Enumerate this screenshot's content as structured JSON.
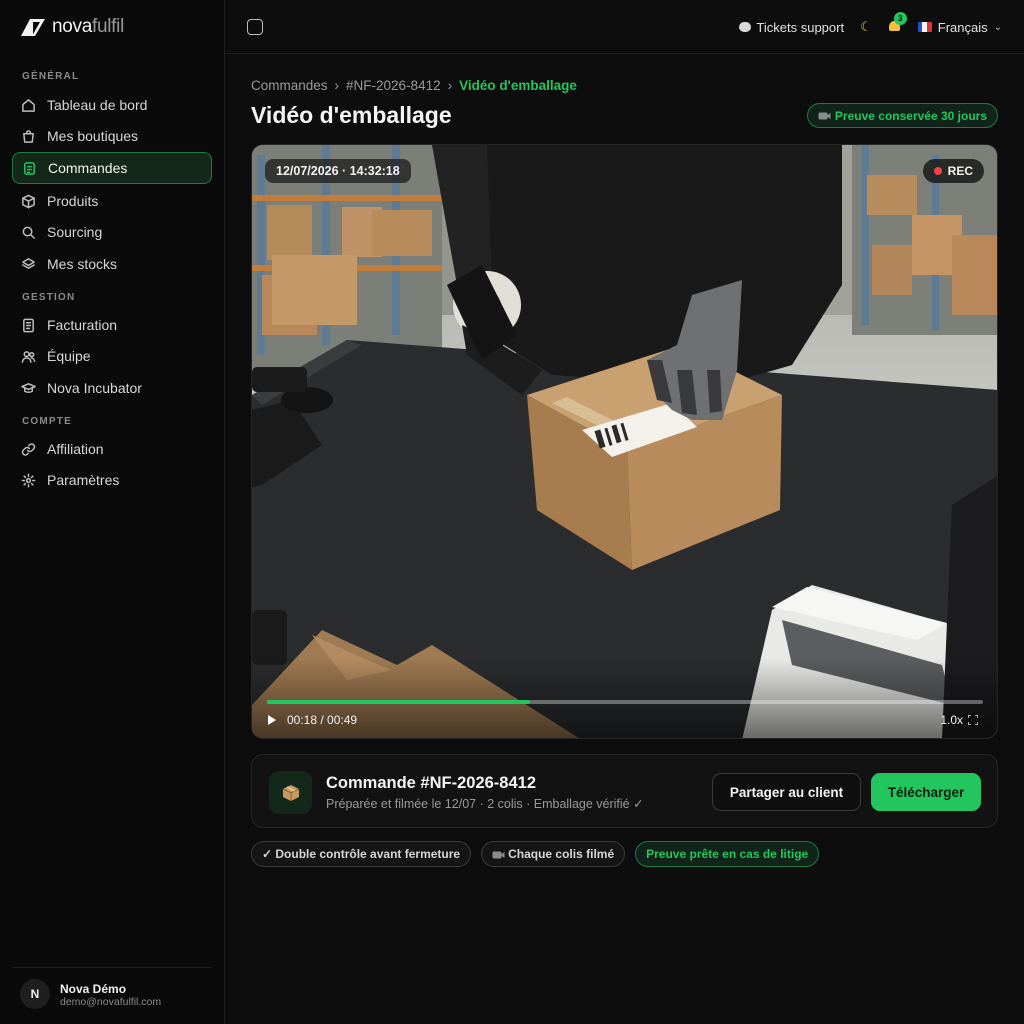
{
  "brand": {
    "name_main": "nova",
    "name_light": "fulfil"
  },
  "sidebar": {
    "sections": [
      {
        "label": "GÉNÉRAL"
      },
      {
        "label": "GESTION"
      },
      {
        "label": "COMPTE"
      }
    ],
    "items": [
      {
        "label": "Tableau de bord",
        "icon": "home-icon"
      },
      {
        "label": "Mes boutiques",
        "icon": "shopping-bag-icon"
      },
      {
        "label": "Commandes",
        "icon": "clipboard-icon",
        "active": true
      },
      {
        "label": "Produits",
        "icon": "cube-icon"
      },
      {
        "label": "Sourcing",
        "icon": "search-icon"
      },
      {
        "label": "Mes stocks",
        "icon": "layers-icon"
      },
      {
        "label": "Facturation",
        "icon": "invoice-icon"
      },
      {
        "label": "Équipe",
        "icon": "users-icon"
      },
      {
        "label": "Nova Incubator",
        "icon": "graduation-cap-icon"
      },
      {
        "label": "Affiliation",
        "icon": "link-icon"
      },
      {
        "label": "Paramètres",
        "icon": "gear-icon"
      }
    ],
    "user": {
      "initial": "N",
      "name": "Nova Démo",
      "email": "demo@novafulfil.com"
    }
  },
  "topbar": {
    "tickets_label": "Tickets support",
    "notification_count": "3",
    "language": "Français"
  },
  "breadcrumb": {
    "items": [
      "Commandes",
      "#NF-2026-8412",
      "Vidéo d'emballage"
    ],
    "separator": "›"
  },
  "page": {
    "title": "Vidéo d'emballage",
    "proof_pill": "Preuve conservée 30 jours"
  },
  "video": {
    "timestamp": "12/07/2026 · 14:32:18",
    "rec_label": "REC",
    "current_time": "00:18",
    "duration": "00:49",
    "time_display": "00:18 / 00:49",
    "progress_fraction": 0.367,
    "speed": "1.0x"
  },
  "order": {
    "title": "Commande #NF-2026-8412",
    "subtitle": "Préparée et filmée le 12/07 · 2 colis · Emballage vérifié ✓",
    "share_label": "Partager au client",
    "download_label": "Télécharger"
  },
  "tags": [
    {
      "label": "✓ Double contrôle avant fermeture",
      "style": "neutral"
    },
    {
      "label": "Chaque colis filmé",
      "style": "neutral",
      "icon": "camera-icon"
    },
    {
      "label": "Preuve prête en cas de litige",
      "style": "green"
    }
  ],
  "colors": {
    "accent": "#22c55e",
    "background": "#0d0d0d",
    "recording": "#ef4444"
  }
}
